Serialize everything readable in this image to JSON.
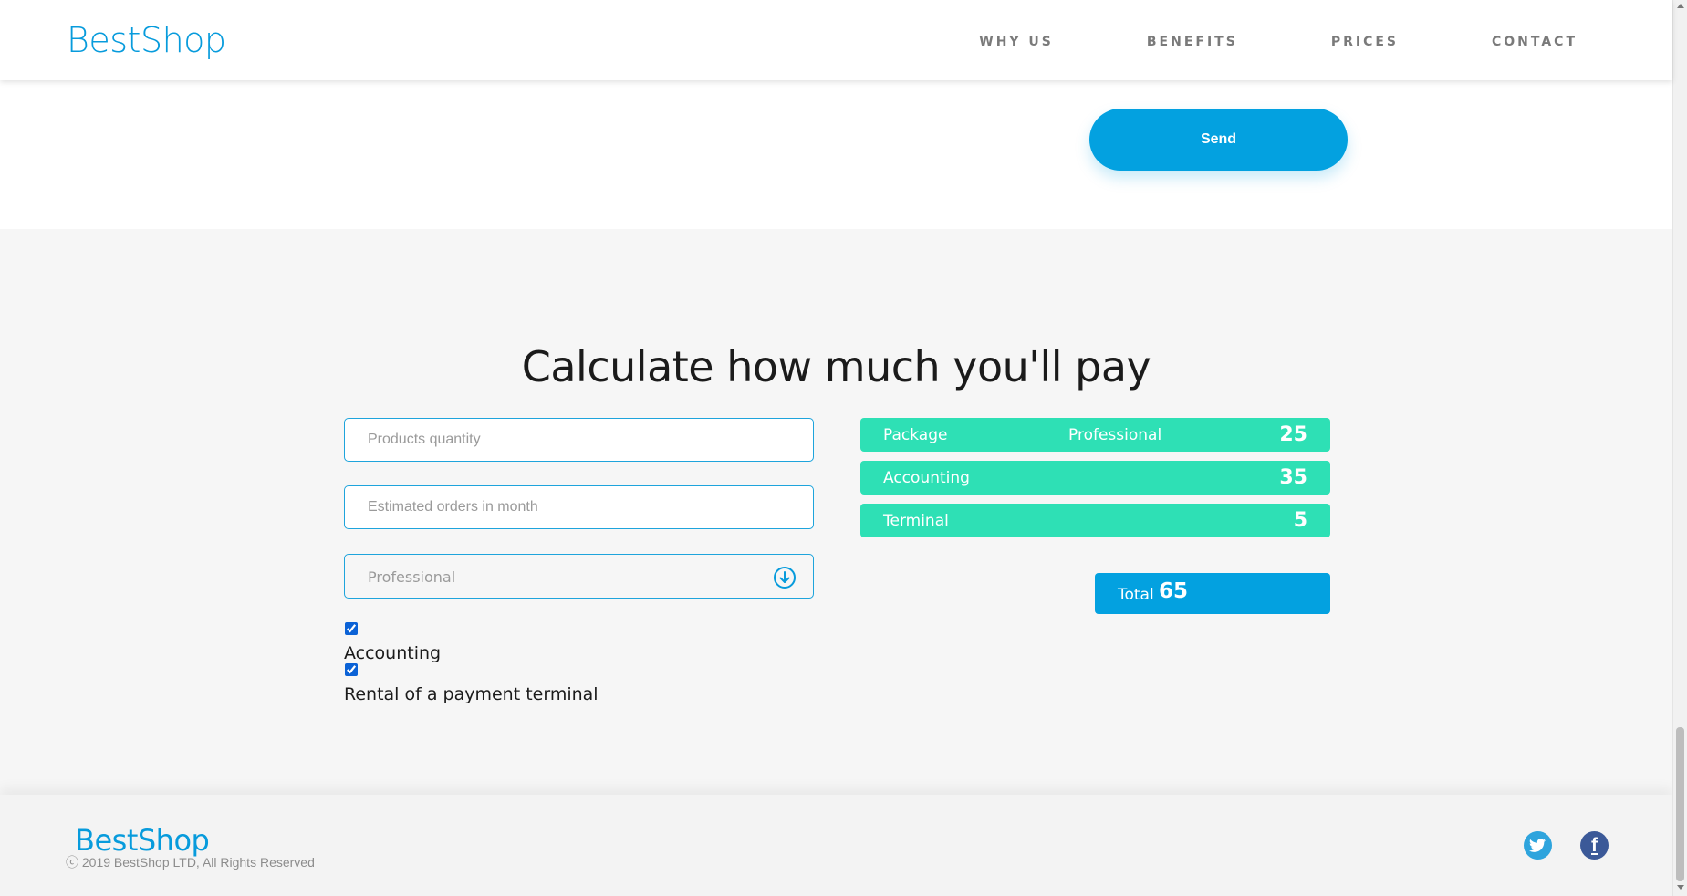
{
  "header": {
    "logo": "BestShop",
    "nav": [
      {
        "label": "WHY US"
      },
      {
        "label": "BENEFITS"
      },
      {
        "label": "PRICES"
      },
      {
        "label": "CONTACT"
      }
    ]
  },
  "contact": {
    "send_label": "Send"
  },
  "calculator": {
    "title": "Calculate how much you'll pay",
    "products_placeholder": "Products quantity",
    "orders_placeholder": "Estimated orders in month",
    "package_select_value": "Professional",
    "accounting_label": "Accounting",
    "terminal_label": "Rental of a payment terminal",
    "accounting_checked": true,
    "terminal_checked": true,
    "summary": {
      "package": {
        "name": "Package",
        "value": "Professional",
        "price": "25"
      },
      "accounting": {
        "name": "Accounting",
        "price": "35"
      },
      "terminal": {
        "name": "Terminal",
        "price": "5"
      }
    },
    "total_label": "Total",
    "total_value": "65"
  },
  "footer": {
    "logo": "BestShop",
    "copyright": "ⓒ 2019 BestShop LTD, All Rights Reserved",
    "social": [
      {
        "name": "twitter-icon"
      },
      {
        "name": "facebook-icon"
      }
    ]
  },
  "colors": {
    "brand": "#079bdc",
    "primary_button": "#03a1e0",
    "summary_bg": "#2ee0b5",
    "section_bg": "#f6f6f6"
  }
}
